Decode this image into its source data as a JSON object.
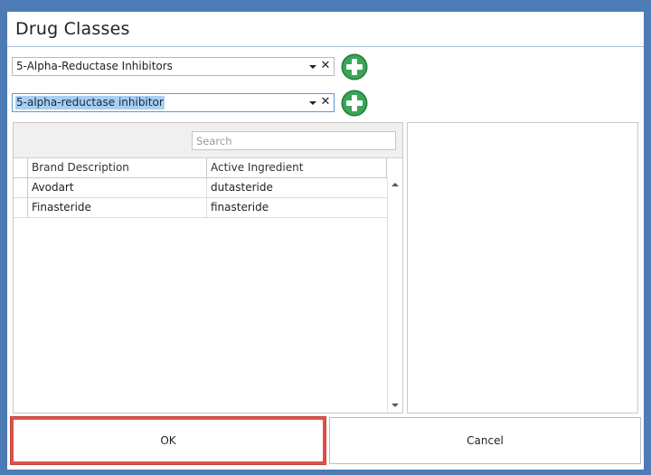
{
  "dialog": {
    "title": "Drug Classes"
  },
  "class_combo": {
    "value": "5-Alpha-Reductase Inhibitors",
    "clear_symbol": "✕"
  },
  "subclass_combo": {
    "value": "5-alpha-reductase inhibitor",
    "clear_symbol": "✕",
    "selected": true
  },
  "grid": {
    "search_placeholder": "Search",
    "columns": [
      "Brand Description",
      "Active Ingredient"
    ],
    "rows": [
      [
        "Avodart",
        "dutasteride"
      ],
      [
        "Finasteride",
        "finasteride"
      ]
    ]
  },
  "buttons": {
    "ok_label": "OK",
    "cancel_label": "Cancel"
  },
  "colors": {
    "background": "#4d7bb5",
    "add_button_green": "#3aa657",
    "ok_highlight": "#e0514a",
    "selection": "#a8cff2"
  },
  "icons": {
    "add": "plus-circle-icon",
    "dropdown": "chevron-down-icon",
    "clear": "close-icon"
  }
}
